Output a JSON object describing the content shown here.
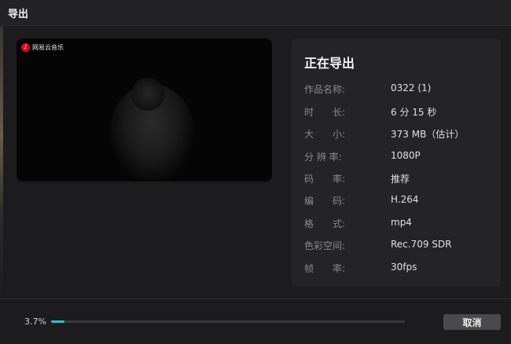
{
  "window": {
    "title": "导出"
  },
  "preview": {
    "watermark_text": "网易云音乐",
    "watermark_icon": "netease-music-logo-icon"
  },
  "info": {
    "heading": "正在导出",
    "rows": [
      {
        "label": "作品名称:",
        "value": "0322 (1)"
      },
      {
        "label": "时　　长:",
        "value": "6 分 15 秒"
      },
      {
        "label": "大　　小:",
        "value": "373 MB（估计）"
      },
      {
        "label": "分 辨 率:",
        "value": "1080P"
      },
      {
        "label": "码　　率:",
        "value": "推荐"
      },
      {
        "label": "编　　码:",
        "value": "H.264"
      },
      {
        "label": "格　　式:",
        "value": "mp4"
      },
      {
        "label": "色彩空间:",
        "value": "Rec.709 SDR"
      },
      {
        "label": "帧　　率:",
        "value": "30fps"
      }
    ]
  },
  "progress": {
    "percent_text": "3.7%",
    "fraction": 0.037
  },
  "actions": {
    "cancel_label": "取消"
  },
  "colors": {
    "accent": "#22c7d6",
    "brand_red": "#e60026"
  }
}
